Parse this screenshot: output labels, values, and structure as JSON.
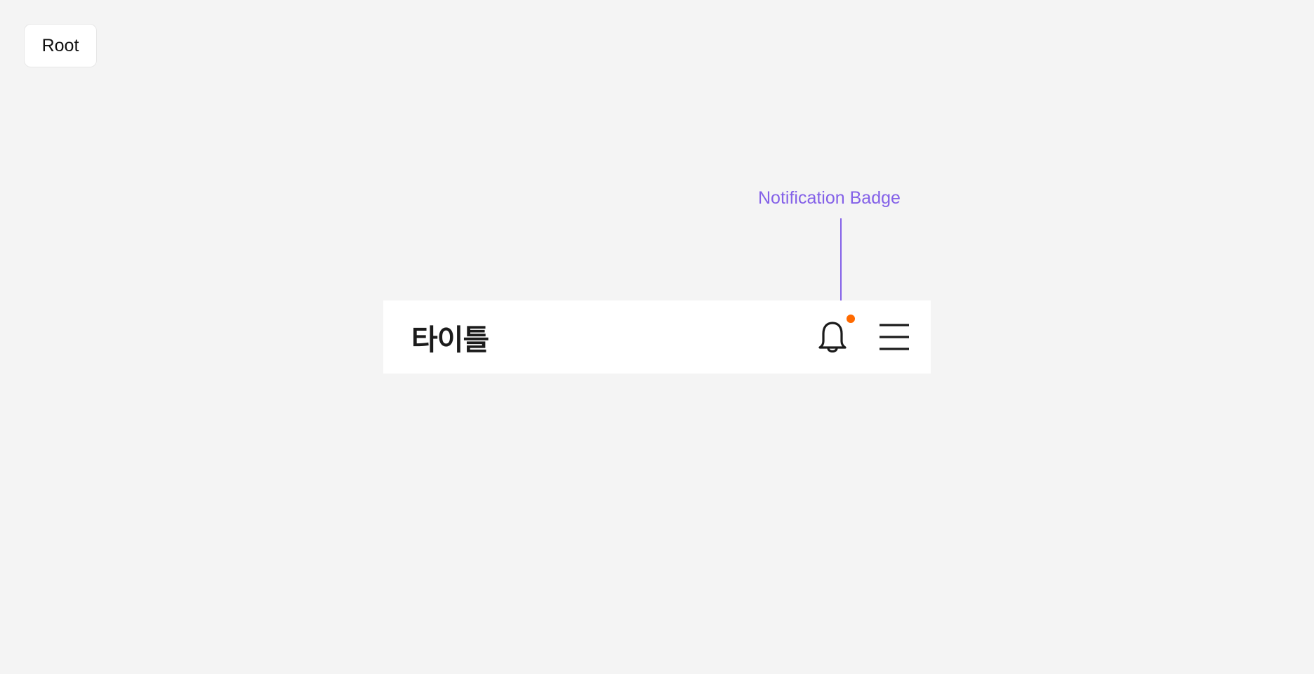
{
  "root_chip": {
    "label": "Root"
  },
  "annotation": {
    "label": "Notification Badge",
    "color": "#8461e8"
  },
  "app_bar": {
    "title": "타이틀",
    "bell_icon": "bell-icon",
    "menu_icon": "hamburger-menu-icon",
    "badge_color": "#ff6a00",
    "icon_color": "#1b1b1b",
    "background_color": "#ffffff"
  }
}
